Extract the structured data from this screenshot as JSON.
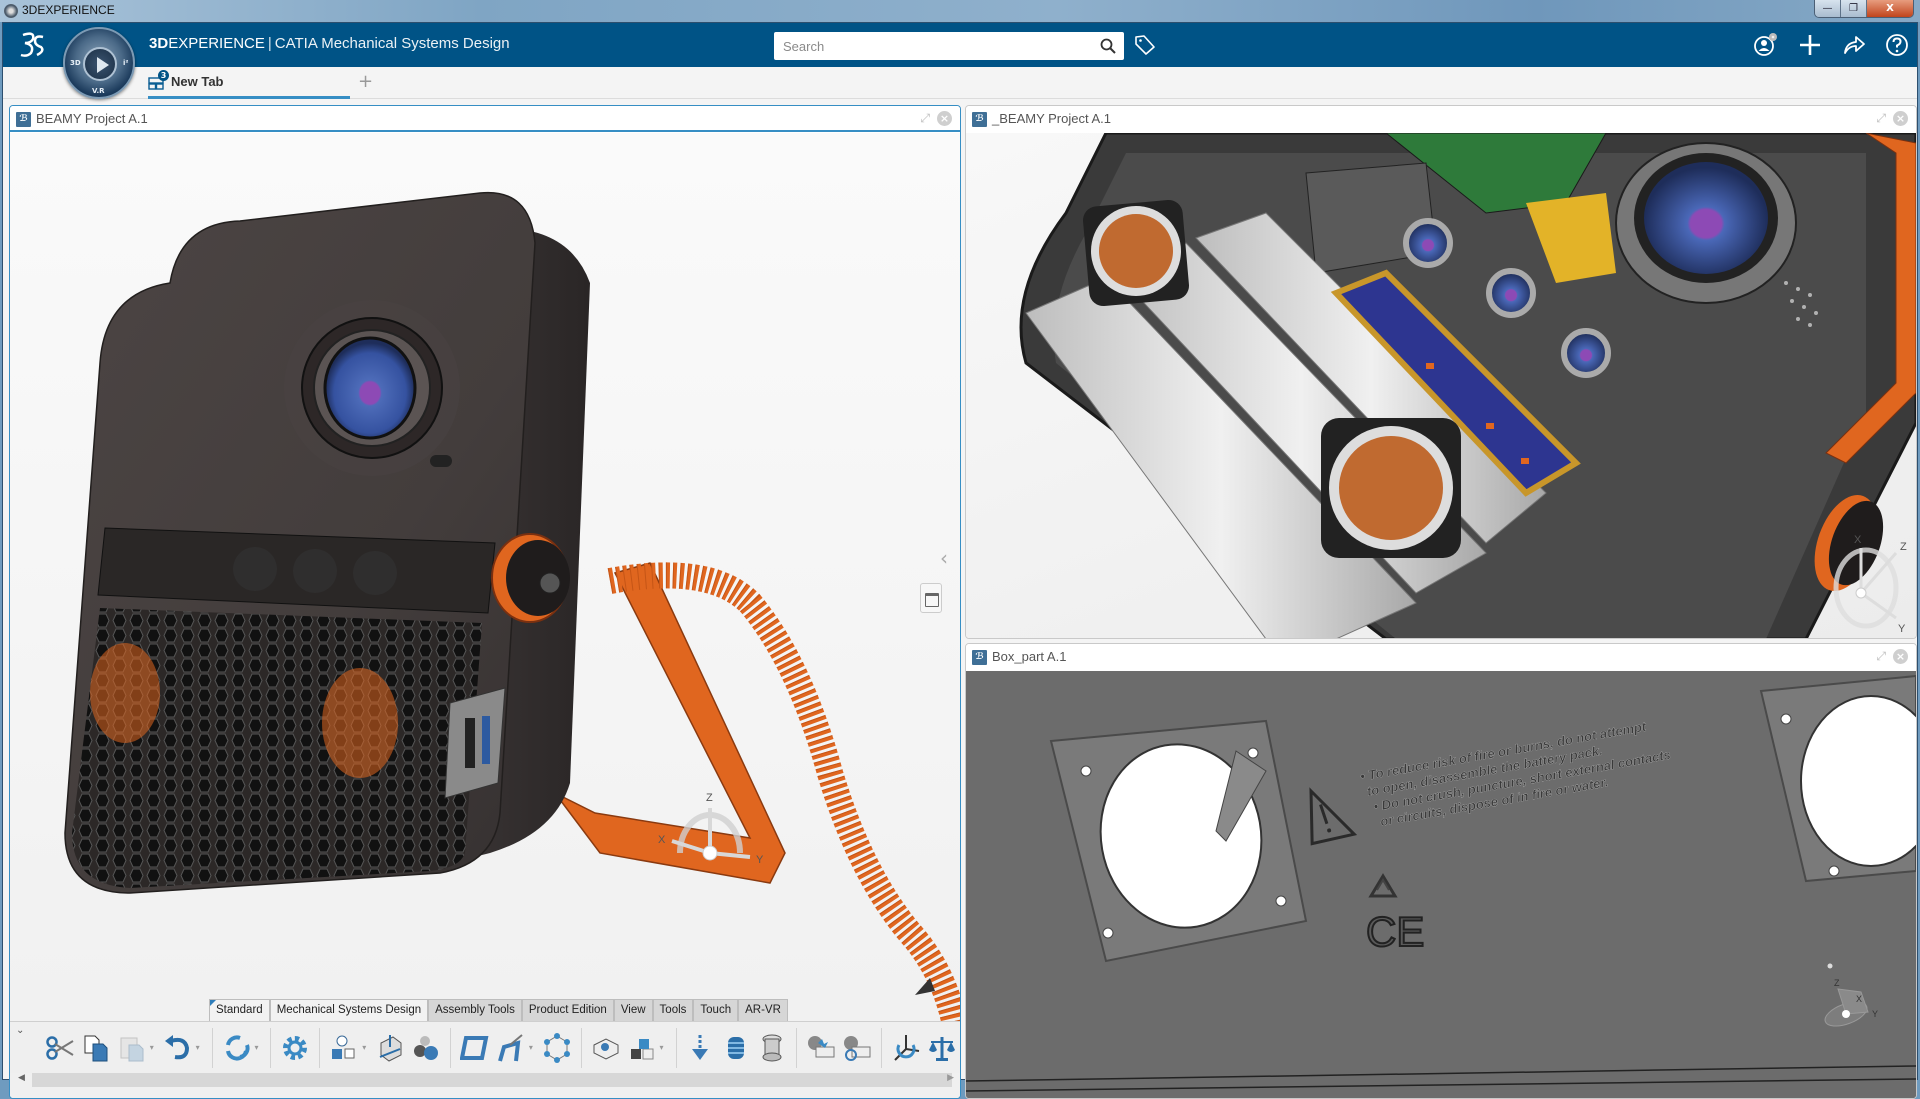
{
  "window": {
    "title": "3DEXPERIENCE",
    "controls": {
      "minimize": "—",
      "restore": "❐",
      "close": "X"
    }
  },
  "topbar": {
    "brand_bold": "3D",
    "brand_rest": "EXPERIENCE",
    "separator": "|",
    "app_name": "CATIA Mechanical Systems Design",
    "compass_labels": {
      "left": "3D",
      "right": "i²",
      "bottom": "V.R"
    },
    "search": {
      "value": "",
      "placeholder": "Search"
    },
    "icons": [
      "search-icon",
      "tag-icon",
      "user-profile-icon",
      "add-icon",
      "share-icon",
      "help-icon"
    ]
  },
  "tabs": {
    "items": [
      {
        "label": "New Tab",
        "badge": "3",
        "active": true
      }
    ],
    "add_label": "+"
  },
  "panels": [
    {
      "id": "p1",
      "title": "BEAMY Project A.1",
      "active": true,
      "compass": {
        "x": "X",
        "y": "Y",
        "z": "Z"
      }
    },
    {
      "id": "p2",
      "title": "_BEAMY Project A.1",
      "active": false,
      "compass": {
        "x": "X",
        "y": "Y",
        "z": "Z"
      }
    },
    {
      "id": "p3",
      "title": "Box_part A.1",
      "active": false,
      "compass": {
        "x": "X",
        "y": "Y",
        "z": "Z"
      },
      "embossed_text": [
        "• To reduce risk of fire or burns, do not attempt",
        "to open, disassemble the battery pack.",
        "• Do not crush, puncture, short external contacts",
        "or circuits, dispose of in fire or water."
      ],
      "embossed_mark": "CE"
    }
  ],
  "action_bar": {
    "tabs": [
      {
        "label": "Standard",
        "active": true
      },
      {
        "label": "Mechanical Systems Design",
        "active": true
      },
      {
        "label": "Assembly Tools",
        "active": false
      },
      {
        "label": "Product Edition",
        "active": false
      },
      {
        "label": "View",
        "active": false
      },
      {
        "label": "Tools",
        "active": false
      },
      {
        "label": "Touch",
        "active": false
      },
      {
        "label": "AR-VR",
        "active": false
      }
    ],
    "commands": [
      "cut-icon",
      "copy-icon",
      "paste-icon",
      "undo-icon",
      "update-icon",
      "properties-gear-icon",
      "engineering-connection-icon",
      "fix-constraint-icon",
      "spheres-icon",
      "mechanism-icon",
      "kinematic-joint-icon",
      "network-icon",
      "manipulate-icon",
      "insert-part-icon",
      "drop-icon",
      "spring-icon",
      "bushing-icon",
      "clash-icon",
      "clash-filter-icon",
      "axis-system-icon",
      "balance-icon"
    ]
  },
  "colors": {
    "topbar": "#005386",
    "accent": "#368ec4",
    "device_body": "#4a4443",
    "orange": "#e0661f",
    "lens_blue": "#3d5aa6",
    "lens_purple": "#8d4ab5",
    "part_grey": "#6a6a6a"
  }
}
